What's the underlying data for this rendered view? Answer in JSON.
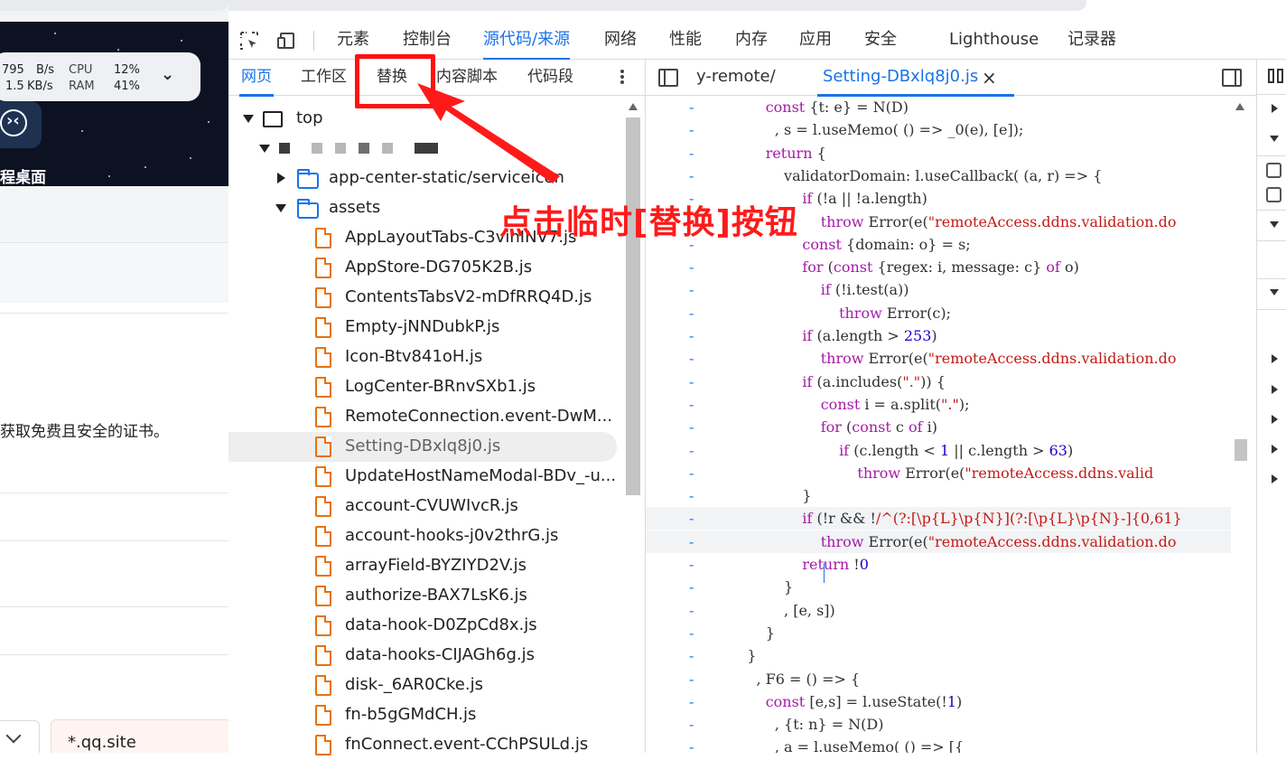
{
  "left_page": {
    "widget": {
      "net_up": "795",
      "net_up_unit": "B/s",
      "net_down": "1.5",
      "net_down_unit": "KB/s",
      "cpu_label": "CPU",
      "cpu_value": "12%",
      "ram_label": "RAM",
      "ram_value": "41%"
    },
    "hero_label": "程桌面",
    "body_text": "获取免费且安全的证书。",
    "domain_input": "*.qq.site"
  },
  "devtools": {
    "main_tabs": [
      "元素",
      "控制台",
      "源代码/来源",
      "网络",
      "性能",
      "内存",
      "应用",
      "安全",
      "Lighthouse",
      "记录器"
    ],
    "active_main_tab": "源代码/来源",
    "sub_tabs": [
      "网页",
      "工作区",
      "替换",
      "内容脚本",
      "代码段"
    ],
    "active_sub_tab": "网页",
    "tree": {
      "top": "top",
      "folders": [
        "app-center-static/serviceicon",
        "assets"
      ],
      "files": [
        "AppLayoutTabs-C3vinINV7.js",
        "AppStore-DG705K2B.js",
        "ContentsTabsV2-mDfRRQ4D.js",
        "Empty-jNNDubkP.js",
        "Icon-Btv841oH.js",
        "LogCenter-BRnvSXb1.js",
        "RemoteConnection.event-DwM...",
        "Setting-DBxlq8j0.js",
        "UpdateHostNameModal-BDv_-u...",
        "account-CVUWIvcR.js",
        "account-hooks-j0v2thrG.js",
        "arrayField-BYZIYD2V.js",
        "authorize-BAX7LsK6.js",
        "data-hook-D0ZpCd8x.js",
        "data-hooks-CIJAGh6g.js",
        "disk-_6AR0Cke.js",
        "fn-b5gGMdCH.js",
        "fnConnect.event-CChPSULd.js"
      ],
      "selected_file": "Setting-DBxlq8j0.js"
    },
    "editor": {
      "breadcrumb_tab": "y-remote/",
      "open_file": "Setting-DBxlq8j0.js",
      "close_glyph": "×",
      "gutter_mark": "-",
      "lines": [
        "        const {t: e} = N(D)",
        "          , s = l.useMemo( () => _0(e), [e]);",
        "        return {",
        "            validatorDomain: l.useCallback( (a, r) => {",
        "                if (!a || !a.length)",
        "                    throw Error(e(\"remoteAccess.ddns.validation.do",
        "                const {domain: o} = s;",
        "                for (const {regex: i, message: c} of o)",
        "                    if (!i.test(a))",
        "                        throw Error(c);",
        "                if (a.length > 253)",
        "                    throw Error(e(\"remoteAccess.ddns.validation.do",
        "                if (a.includes(\".\")) {",
        "                    const i = a.split(\".\");",
        "                    for (const c of i)",
        "                        if (c.length < 1 || c.length > 63)",
        "                            throw Error(e(\"remoteAccess.ddns.valid",
        "                }",
        "                if (!r && !/^(?:[\\p{L}\\p{N}](?:[\\p{L}\\p{N}-]{0,61}",
        "                    throw Error(e(\"remoteAccess.ddns.validation.do",
        "                return !0",
        "            }",
        "            , [e, s])",
        "        }",
        "    }",
        "      , F6 = () => {",
        "        const [e,s] = l.useState(!1)",
        "          , {t: n} = N(D)",
        "          , a = l.useMemo( () => [{"
      ]
    }
  },
  "annotation": {
    "text": "点击临时[替换]按钮",
    "color": "#ff1a1a"
  },
  "colors": {
    "accent": "#1a73e8",
    "annotation": "#ff1a1a",
    "file_icon": "#e8710a"
  }
}
